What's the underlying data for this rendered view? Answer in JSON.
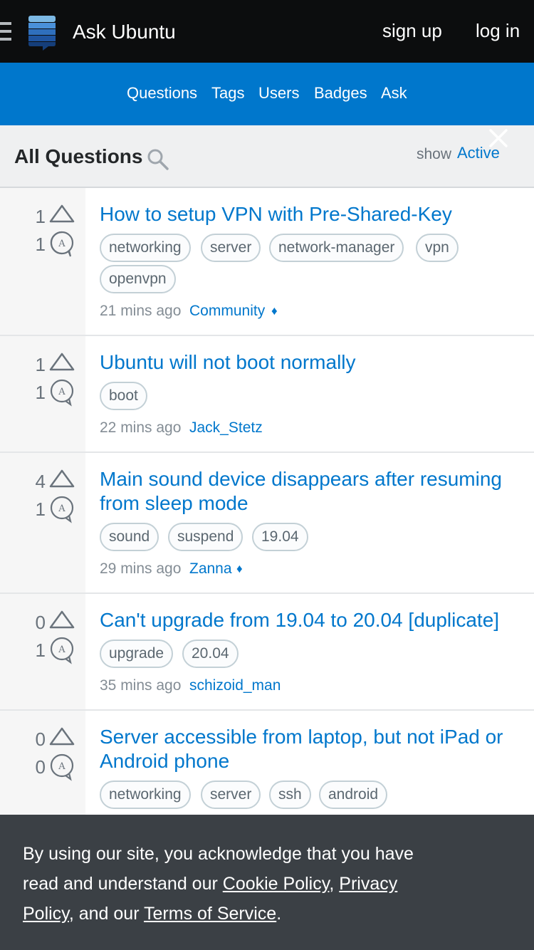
{
  "header": {
    "site_title": "Ask Ubuntu",
    "signup_label": "sign up",
    "login_label": "log in",
    "menu_icon": "hamburger-icon",
    "logo_icon": "stack-exchange-logo"
  },
  "nav": {
    "items": [
      {
        "label": "Questions"
      },
      {
        "label": "Tags"
      },
      {
        "label": "Users"
      },
      {
        "label": "Badges"
      },
      {
        "label": "Ask"
      }
    ]
  },
  "subheader": {
    "title": "All Questions",
    "show_label": "show",
    "show_value": "Active",
    "search_icon": "search-icon"
  },
  "questions": [
    {
      "votes": "1",
      "answers": "1",
      "title": "How to setup VPN with Pre-Shared-Key",
      "tags": [
        "networking",
        "server",
        "network-manager",
        "vpn",
        "openvpn"
      ],
      "time": "21 mins ago",
      "user": "Community",
      "moderator": "♦"
    },
    {
      "votes": "1",
      "answers": "1",
      "title": "Ubuntu will not boot normally",
      "tags": [
        "boot"
      ],
      "time": "22 mins ago",
      "user": "Jack_Stetz",
      "moderator": ""
    },
    {
      "votes": "4",
      "answers": "1",
      "title_line1": "Main sound device disappears after resuming",
      "title_line2": "from sleep mode",
      "tags": [
        "sound",
        "suspend",
        "19.04"
      ],
      "time": "29 mins ago",
      "user": "Zanna",
      "moderator": "♦"
    },
    {
      "votes": "0",
      "answers": "1",
      "title": "Can't upgrade from 19.04 to 20.04 [duplicate]",
      "tags": [
        "upgrade",
        "20.04"
      ],
      "time": "35 mins ago",
      "user": "schizoid_man",
      "moderator": ""
    },
    {
      "votes": "0",
      "answers": "0",
      "title_line1": "Server accessible from laptop, but not iPad or",
      "title_line2": "Android phone",
      "tags": [
        "networking",
        "server",
        "ssh",
        "android"
      ]
    }
  ],
  "cookie": {
    "text_1": "By using our site, you acknowledge that you have read and understand our ",
    "link_cookie": "Cookie Policy",
    "sep_1": ", ",
    "link_privacy": "Privacy Policy",
    "text_2": ", and our ",
    "link_terms": "Terms of Service",
    "text_3": ".",
    "close_icon": "close-icon"
  },
  "colors": {
    "topbar": "#0c0d0e",
    "brand_blue": "#0077cc",
    "link": "#0077cc",
    "cookie_bg": "#3b4045"
  }
}
